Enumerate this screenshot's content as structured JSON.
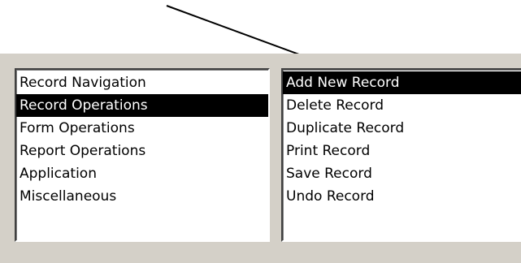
{
  "categories": {
    "items": [
      {
        "label": "Record Navigation",
        "selected": false
      },
      {
        "label": "Record Operations",
        "selected": true
      },
      {
        "label": "Form Operations",
        "selected": false
      },
      {
        "label": "Report Operations",
        "selected": false
      },
      {
        "label": "Application",
        "selected": false
      },
      {
        "label": "Miscellaneous",
        "selected": false
      }
    ]
  },
  "actions": {
    "items": [
      {
        "label": "Add New Record",
        "selected": true
      },
      {
        "label": "Delete Record",
        "selected": false
      },
      {
        "label": "Duplicate Record",
        "selected": false
      },
      {
        "label": "Print Record",
        "selected": false
      },
      {
        "label": "Save Record",
        "selected": false
      },
      {
        "label": "Undo Record",
        "selected": false
      }
    ]
  },
  "colors": {
    "dialog_bg": "#d4d0c8",
    "selection_bg": "#000000",
    "selection_text": "#ffffff",
    "arrow": "#000000"
  }
}
